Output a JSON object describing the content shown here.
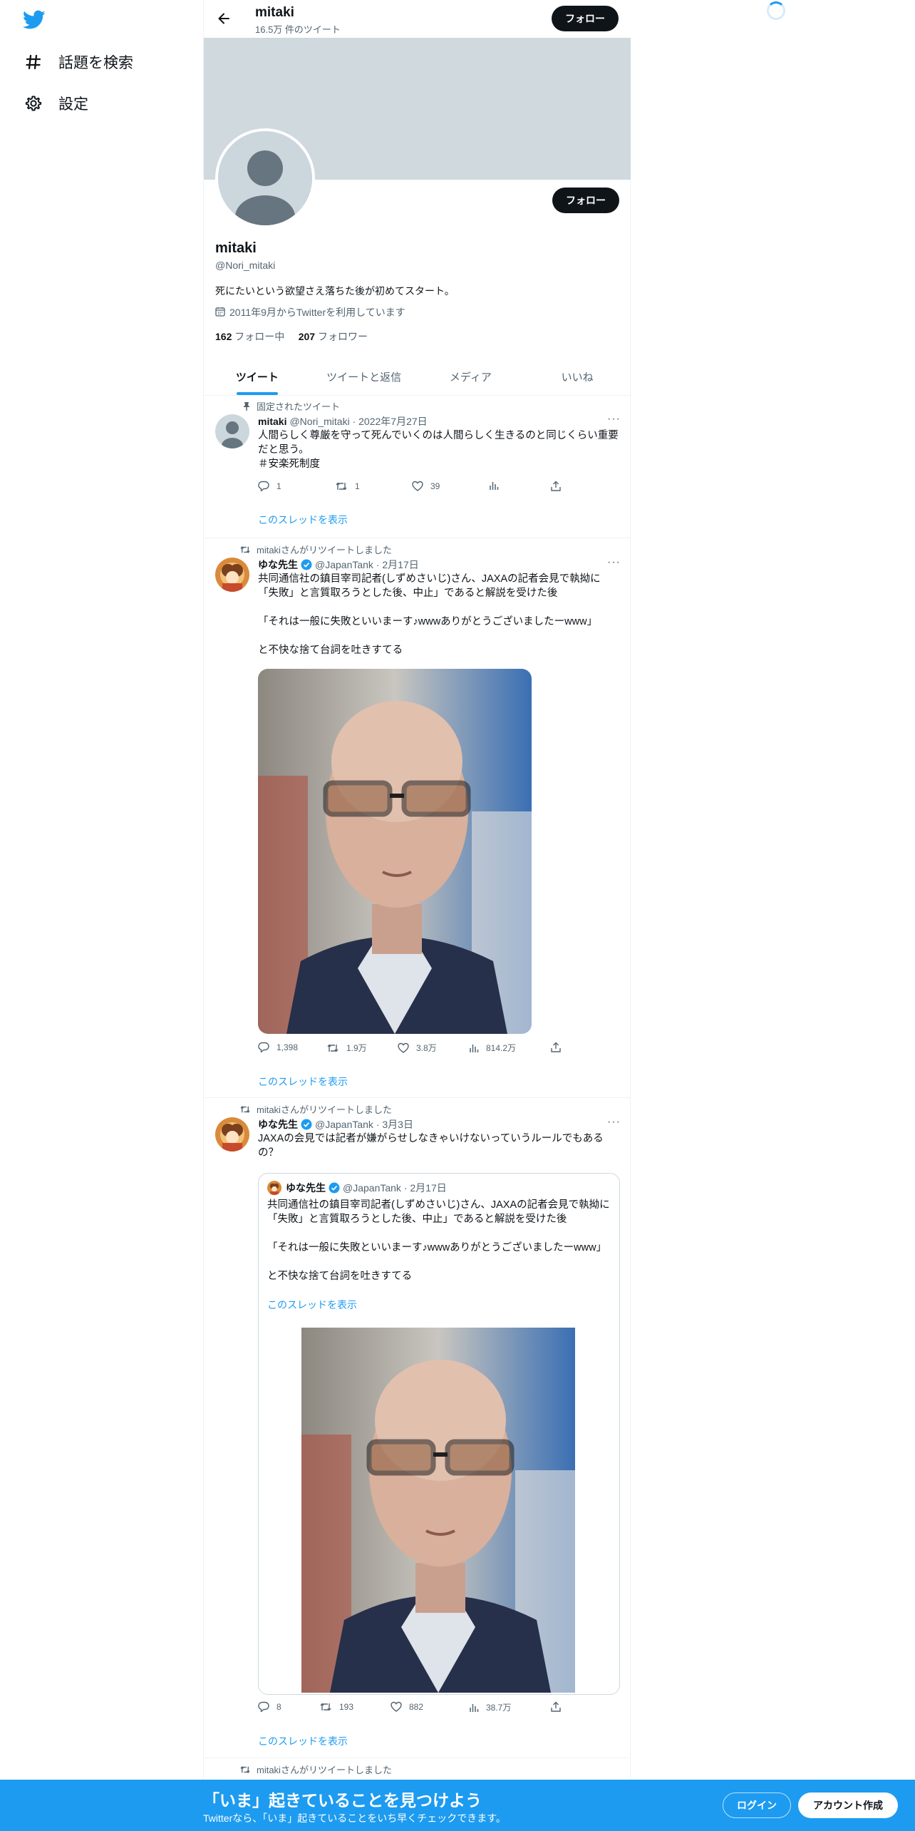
{
  "nav": {
    "explore_label": "話題を検索",
    "settings_label": "設定"
  },
  "header": {
    "name": "mitaki",
    "tweet_count": "16.5万 件のツイート",
    "follow_label": "フォロー"
  },
  "profile": {
    "name": "mitaki",
    "handle": "@Nori_mitaki",
    "bio": "死にたいという欲望さえ落ちた後が初めてスタート。",
    "joined": "2011年9月からTwitterを利用しています",
    "following_count": "162",
    "following_label": " フォロー中",
    "followers_count": "207",
    "followers_label": " フォロワー",
    "follow_label": "フォロー"
  },
  "tabs": [
    "ツイート",
    "ツイートと返信",
    "メディア",
    "いいね"
  ],
  "tweets": [
    {
      "context": "固定されたツイート",
      "name": "mitaki",
      "handle": "@Nori_mitaki",
      "date": "· 2022年7月27日",
      "text": "人間らしく尊厳を守って死んでいくのは人間らしく生きるのと同じくらい重要だと思う。\n＃安楽死制度",
      "replies": "1",
      "retweets": "1",
      "likes": "39",
      "views": "",
      "show_thread": "このスレッドを表示"
    },
    {
      "context": "mitakiさんがリツイートしました",
      "name": "ゆな先生",
      "handle": "@JapanTank",
      "date": "· 2月17日",
      "text": "共同通信社の鎮目宰司記者(しずめさいじ)さん、JAXAの記者会見で執拗に「失敗」と言質取ろうとした後、中止」であると解説を受けた後\n\n「それは一般に失敗といいまーす♪wwwありがとうございましたーwww」\n\nと不快な捨て台詞を吐きすてる",
      "replies": "1,398",
      "retweets": "1.9万",
      "likes": "3.8万",
      "views": "814.2万",
      "show_thread": "このスレッドを表示"
    },
    {
      "context": "mitakiさんがリツイートしました",
      "name": "ゆな先生",
      "handle": "@JapanTank",
      "date": "· 3月3日",
      "text": "JAXAの会見では記者が嫌がらせしなきゃいけないっていうルールでもあるの？",
      "quote": {
        "name": "ゆな先生",
        "handle": "@JapanTank",
        "date": "· 2月17日",
        "text": "共同通信社の鎮目宰司記者(しずめさいじ)さん、JAXAの記者会見で執拗に「失敗」と言質取ろうとした後、中止」であると解説を受けた後\n\n「それは一般に失敗といいまーす♪wwwありがとうございましたーwww」\n\nと不快な捨て台詞を吐きすてる",
        "show_thread": "このスレッドを表示"
      },
      "replies": "8",
      "retweets": "193",
      "likes": "882",
      "views": "38.7万",
      "show_thread": "このスレッドを表示"
    },
    {
      "context": "mitakiさんがリツイートしました"
    }
  ],
  "bottom_bar": {
    "title": "「いま」起きていることを見つけよう",
    "subtitle": "Twitterなら、「いま」起きていることをいち早くチェックできます。",
    "login_label": "ログイン",
    "signup_label": "アカウント作成"
  },
  "colors": {
    "accent": "#1d9bf0",
    "banner": "#cfd9de",
    "text": "#0f1419",
    "muted": "#536471"
  },
  "icons": [
    "twitter-logo-icon",
    "hashtag-icon",
    "gear-icon",
    "back-arrow-icon",
    "calendar-icon",
    "pin-icon",
    "retweet-icon",
    "verified-icon",
    "reply-icon",
    "like-icon",
    "views-icon",
    "share-icon",
    "more-icon",
    "loading-spinner-icon"
  ]
}
